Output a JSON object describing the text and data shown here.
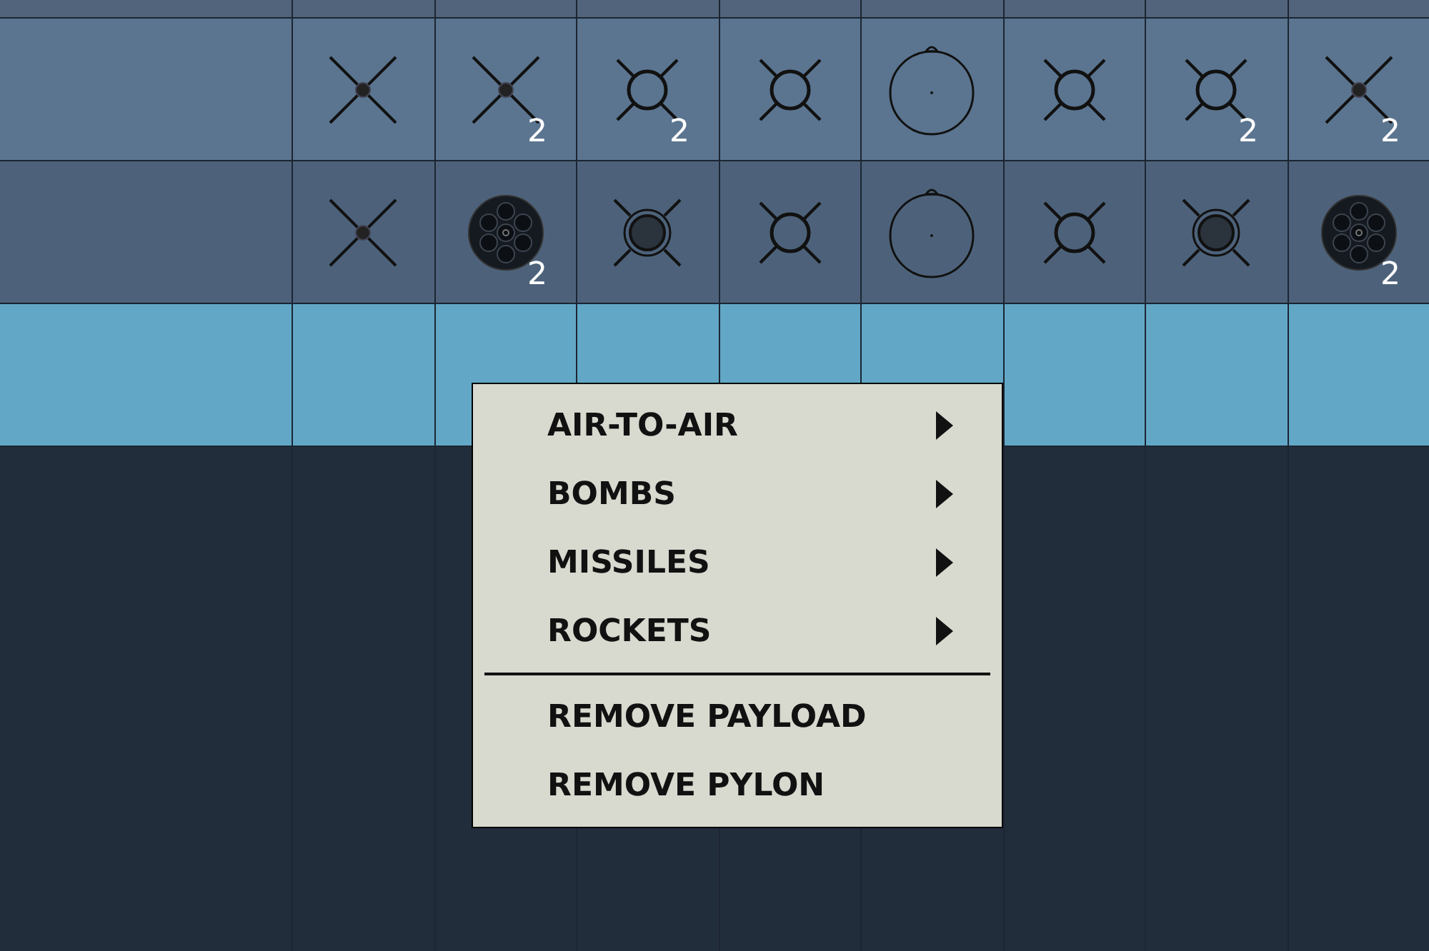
{
  "rows": [
    {
      "selected": false,
      "stations": [
        {
          "kind": "cross"
        },
        {
          "kind": "cross",
          "count": "2"
        },
        {
          "kind": "ring",
          "count": "2"
        },
        {
          "kind": "ring"
        },
        {
          "kind": "tank"
        },
        {
          "kind": "ring"
        },
        {
          "kind": "ring",
          "count": "2"
        },
        {
          "kind": "cross",
          "count": "2"
        }
      ]
    },
    {
      "selected": false,
      "stations": [
        {
          "kind": "cross"
        },
        {
          "kind": "cluster",
          "count": "2"
        },
        {
          "kind": "filled"
        },
        {
          "kind": "ring"
        },
        {
          "kind": "tank"
        },
        {
          "kind": "ring"
        },
        {
          "kind": "filled"
        },
        {
          "kind": "cluster",
          "count": "2"
        }
      ]
    },
    {
      "selected": true,
      "stations": [
        {
          "kind": "empty"
        },
        {
          "kind": "empty"
        },
        {
          "kind": "empty"
        },
        {
          "kind": "empty"
        },
        {
          "kind": "empty"
        },
        {
          "kind": "empty"
        },
        {
          "kind": "empty"
        },
        {
          "kind": "empty"
        }
      ]
    }
  ],
  "context_menu": {
    "items": [
      {
        "kind": "submenu",
        "label": "AIR-TO-AIR"
      },
      {
        "kind": "submenu",
        "label": "BOMBS"
      },
      {
        "kind": "submenu",
        "label": "MISSILES"
      },
      {
        "kind": "submenu",
        "label": "ROCKETS"
      },
      {
        "kind": "separator"
      },
      {
        "kind": "action",
        "label": "REMOVE PAYLOAD"
      },
      {
        "kind": "action",
        "label": "REMOVE PYLON"
      }
    ]
  }
}
